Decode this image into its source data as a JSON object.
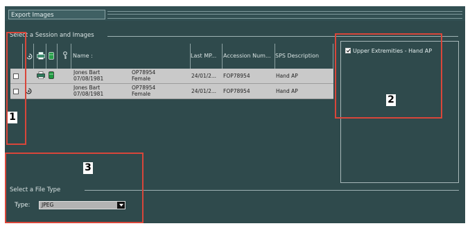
{
  "window": {
    "title": "Export Images"
  },
  "session_section": {
    "label": "Select a Session and Images"
  },
  "grid": {
    "headers": {
      "name": "Name :",
      "last_mpps": "Last MP...",
      "accession": "Accession  Num...",
      "sps": "SPS Description"
    },
    "rows": [
      {
        "name": "Jones Bart",
        "dob": "07/08/1981",
        "patient_id": "OP78954",
        "sex": "Female",
        "last_mpps": "24/01/2...",
        "accession": "FOP78954",
        "sps": "Hand AP"
      },
      {
        "name": "Jones Bart",
        "dob": "07/08/1981",
        "patient_id": "OP78954",
        "sex": "Female",
        "last_mpps": "24/01/2...",
        "accession": "FOP78954",
        "sps": "Hand AP"
      }
    ]
  },
  "images_panel": {
    "items": [
      {
        "label": "Upper Extremities - Hand AP",
        "checked": true
      }
    ]
  },
  "file_type_section": {
    "label": "Select a File Type",
    "type_label": "Type:",
    "selected": "JPEG"
  },
  "callouts": [
    "1",
    "2",
    "3"
  ],
  "colors": {
    "background": "#2f4a4c",
    "row": "#c9c9c9",
    "callout": "#d9463a"
  },
  "icons": [
    "burn-status-icon",
    "print-status-icon",
    "archive-status-icon",
    "key-icon"
  ]
}
